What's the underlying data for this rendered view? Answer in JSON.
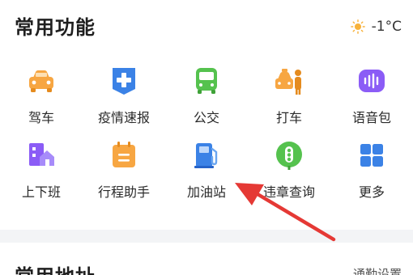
{
  "header": {
    "title": "常用功能",
    "weather": {
      "icon": "sun-icon",
      "temperature": "-1°C"
    }
  },
  "features": [
    {
      "label": "驾车",
      "icon": "car-icon",
      "color": "#F7A642"
    },
    {
      "label": "疫情速报",
      "icon": "medical-cross-icon",
      "color": "#3B82E6"
    },
    {
      "label": "公交",
      "icon": "bus-icon",
      "color": "#55C24E"
    },
    {
      "label": "打车",
      "icon": "taxi-person-icon",
      "color": "#F7A642"
    },
    {
      "label": "语音包",
      "icon": "voice-wave-icon",
      "color": "#8B5CF6"
    },
    {
      "label": "上下班",
      "icon": "commute-house-icon",
      "color": "#8B5CF6"
    },
    {
      "label": "行程助手",
      "icon": "itinerary-calendar-icon",
      "color": "#F7A642"
    },
    {
      "label": "加油站",
      "icon": "gas-pump-icon",
      "color": "#3B82E6"
    },
    {
      "label": "违章查询",
      "icon": "traffic-light-icon",
      "color": "#55C24E"
    },
    {
      "label": "更多",
      "icon": "grid-more-icon",
      "color": "#3B82E6"
    }
  ],
  "section2": {
    "title": "常用地址",
    "link": "通勤设置"
  },
  "annotation": {
    "icon": "red-arrow-pointer",
    "color": "#E53935"
  }
}
